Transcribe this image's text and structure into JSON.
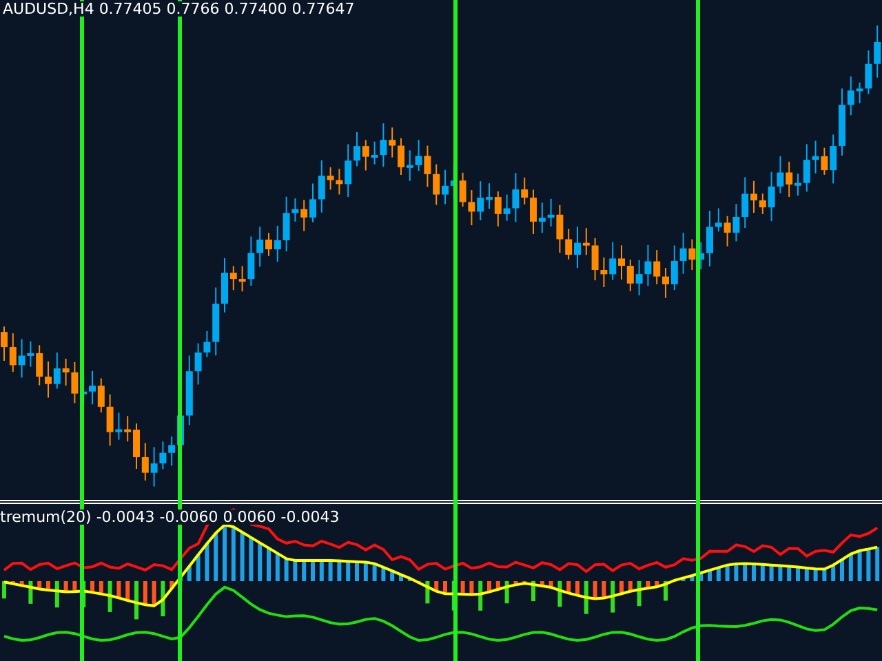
{
  "price_chart": {
    "header": "AUDUSD,H4 0.77405 0.7766 0.77400 0.77647"
  },
  "indicator": {
    "label": "tremum(20) -0.0043 -0.0060 0.0060 -0.0043"
  }
}
